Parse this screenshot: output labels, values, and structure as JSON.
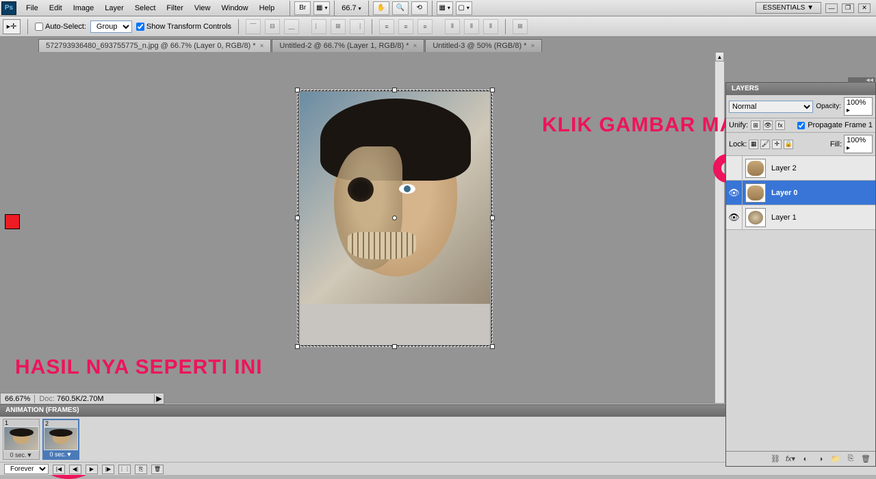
{
  "menu": {
    "items": [
      "File",
      "Edit",
      "Image",
      "Layer",
      "Select",
      "Filter",
      "View",
      "Window",
      "Help"
    ],
    "zoom": "66.7",
    "workspace": "ESSENTIALS ▼"
  },
  "options": {
    "auto_select_label": "Auto-Select:",
    "auto_select_mode": "Group",
    "show_transform_label": "Show Transform Controls"
  },
  "tabs": [
    {
      "title": "572793936480_693755775_n.jpg @ 66.7% (Layer 0, RGB/8) *",
      "active": true
    },
    {
      "title": "Untitled-2 @ 66.7% (Layer 1, RGB/8) *",
      "active": false
    },
    {
      "title": "Untitled-3 @ 50% (RGB/8) *",
      "active": false
    }
  ],
  "status": {
    "zoom": "66.67%",
    "doc_info": "760.5K/2.70M"
  },
  "animation": {
    "panel_title": "ANIMATION (FRAMES)",
    "frames": [
      {
        "num": "1",
        "delay": "0 sec.▼",
        "selected": false
      },
      {
        "num": "2",
        "delay": "0 sec.▼",
        "selected": true
      }
    ],
    "loop": "Forever"
  },
  "layers": {
    "panel_title": "LAYERS",
    "blend_mode": "Normal",
    "opacity_label": "Opacity:",
    "opacity_value": "100%",
    "propagate_label": "Propagate Frame 1",
    "unify_label": "Unify:",
    "lock_label": "Lock:",
    "fill_label": "Fill:",
    "fill_value": "100%",
    "items": [
      {
        "name": "Layer 2",
        "visible": false,
        "selected": false,
        "thumb": "face"
      },
      {
        "name": "Layer 0",
        "visible": true,
        "selected": true,
        "thumb": "face"
      },
      {
        "name": "Layer 1",
        "visible": true,
        "selected": false,
        "thumb": "skull"
      }
    ]
  },
  "annotations": {
    "top_right": "KLIK GAMBAR MATA",
    "bottom_left": "HASIL NYA SEPERTI INI"
  },
  "colors": {
    "foreground": "#ed1c24",
    "background": "#000000"
  }
}
